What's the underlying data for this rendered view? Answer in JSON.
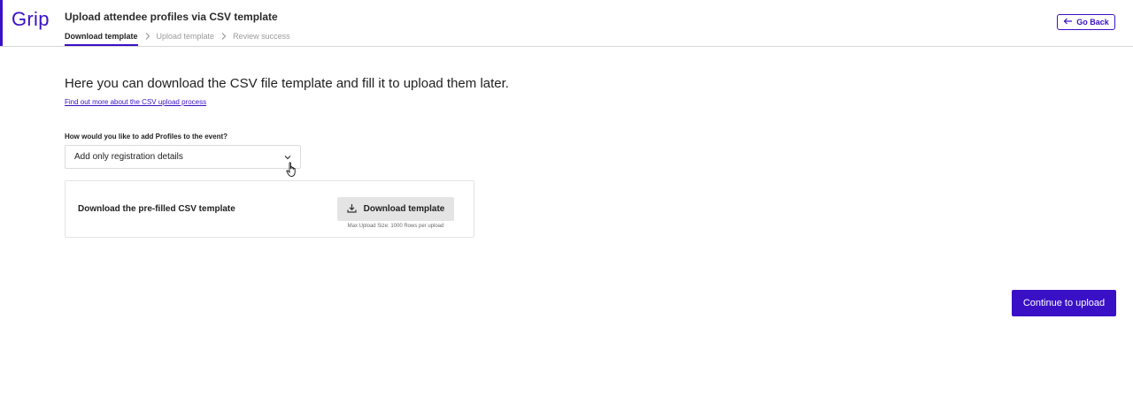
{
  "app": {
    "logo_text": "Grip",
    "brand_color": "#3a10c7"
  },
  "header": {
    "title": "Upload attendee profiles via CSV template",
    "steps": [
      {
        "label": "Download template",
        "active": true
      },
      {
        "label": "Upload template",
        "active": false
      },
      {
        "label": "Review success",
        "active": false
      }
    ],
    "go_back_label": "Go Back",
    "go_back_icon": "arrow-left-icon"
  },
  "main": {
    "headline": "Here you can download the CSV file template and fill it to upload them later.",
    "learn_more_link": "Find out more about the CSV upload process",
    "question_label": "How would you like to add Profiles to the event?",
    "select": {
      "value": "Add only registration details",
      "icon": "chevron-down-icon"
    },
    "download_card": {
      "label": "Download the pre-filled CSV template",
      "button_label": "Download template",
      "button_icon": "download-icon",
      "note": "Max Upload Size: 1000 Rows per upload"
    }
  },
  "footer": {
    "continue_label": "Continue to upload"
  }
}
